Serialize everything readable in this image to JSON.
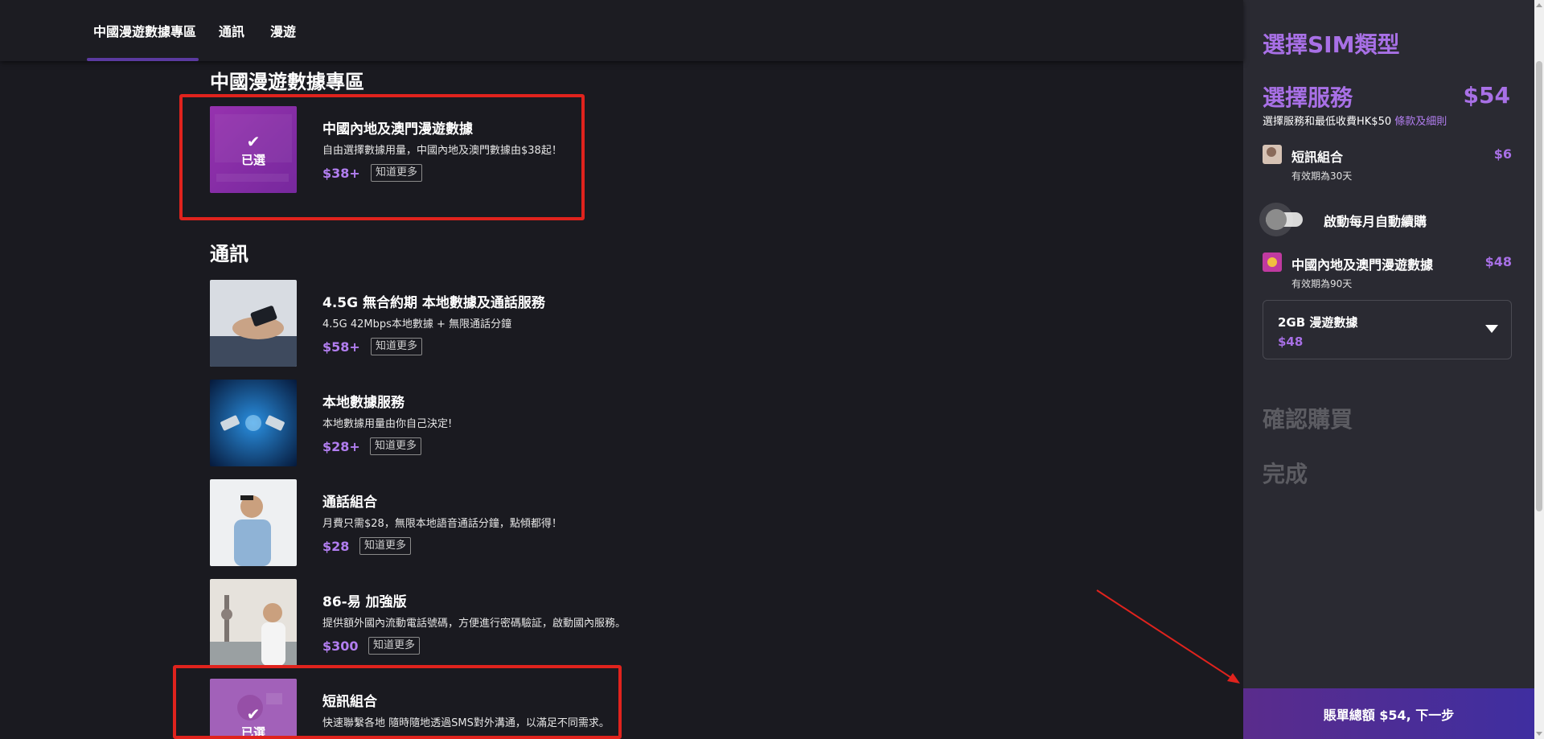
{
  "nav": {
    "tabs": [
      "中國漫遊數據專區",
      "通訊",
      "漫遊"
    ]
  },
  "sections": {
    "roaming_title": "中國漫遊數據專區",
    "comm_title": "通訊"
  },
  "items": [
    {
      "name": "中國內地及澳門漫遊數據",
      "desc": "自由選擇數據用量，中國內地及澳門數據由$38起！",
      "price": "$38+",
      "more": "知道更多",
      "selected_label": "已選",
      "check": "✔"
    },
    {
      "name": "4.5G 無合約期 本地數據及通話服務",
      "desc": "4.5G 42Mbps本地數據 + 無限通話分鐘",
      "price": "$58+",
      "more": "知道更多"
    },
    {
      "name": "本地數據服務",
      "desc": "本地數據用量由你自己決定!",
      "price": "$28+",
      "more": "知道更多"
    },
    {
      "name": "通話組合",
      "desc": "月費只需$28，無限本地語音通話分鐘，點傾都得！",
      "price": "$28",
      "more": "知道更多"
    },
    {
      "name": "86-易 加強版",
      "desc": "提供額外國內流動電話號碼，方便進行密碼驗証，啟動國內服務。",
      "price": "$300",
      "more": "知道更多"
    },
    {
      "name": "短訊組合",
      "desc": "快速聯繫各地 隨時隨地透過SMS對外溝通，以滿足不同需求。",
      "selected_label": "已選",
      "check": "✔"
    }
  ],
  "panel": {
    "sim_title": "選擇SIM類型",
    "service_title": "選擇服務",
    "service_total": "$54",
    "service_note": "選擇服務和最低收費HK$50 ",
    "terms_link": "條款及細則",
    "lines": [
      {
        "name": "短訊組合",
        "price": "$6",
        "validity": "有效期為30天"
      },
      {
        "name": "中國內地及澳門漫遊數據",
        "price": "$48",
        "validity": "有效期為90天"
      }
    ],
    "auto_renew_label": "啟動每月自動續購",
    "select": {
      "value": "2GB 漫遊數據",
      "price": "$48"
    },
    "step_confirm": "確認購買",
    "step_done": "完成",
    "checkout_label": "賬單總額 $54, 下一步"
  },
  "colors": {
    "accent": "#a870e6",
    "price": "#b27ef0",
    "highlight_box": "#e0231d"
  }
}
